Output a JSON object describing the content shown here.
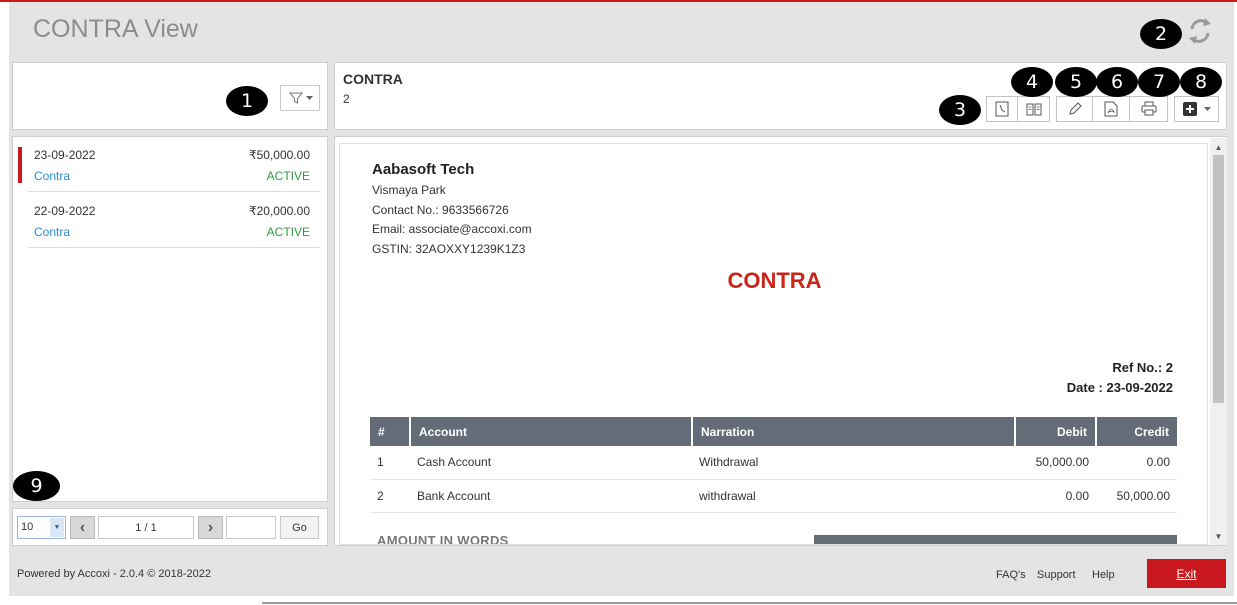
{
  "app": {
    "title": "CONTRA View"
  },
  "callouts": [
    "1",
    "2",
    "3",
    "4",
    "5",
    "6",
    "7",
    "8",
    "9"
  ],
  "list": {
    "items": [
      {
        "date": "23-09-2022",
        "amount": "₹50,000.00",
        "type": "Contra",
        "status": "ACTIVE",
        "selected": true
      },
      {
        "date": "22-09-2022",
        "amount": "₹20,000.00",
        "type": "Contra",
        "status": "ACTIVE",
        "selected": false
      }
    ]
  },
  "pager": {
    "page_size": "10",
    "page_display": "1 / 1",
    "goto_value": "",
    "go_label": "Go"
  },
  "detail": {
    "title": "CONTRA",
    "number": "2",
    "toolbar_icons": [
      "history-icon",
      "ledger-book-icon",
      "pencil-edit-icon",
      "pdf-icon",
      "print-icon",
      "add-dropdown-icon"
    ]
  },
  "document": {
    "company_name": "Aabasoft Tech",
    "address": "Vismaya Park",
    "contact": "Contact No.: 9633566726",
    "email": "Email: associate@accoxi.com",
    "gstin": "GSTIN: 32AOXXY1239K1Z3",
    "title": "CONTRA",
    "ref": "Ref No.: 2",
    "date": "Date : 23-09-2022",
    "table": {
      "headers": [
        "#",
        "Account",
        "Narration",
        "Debit",
        "Credit"
      ],
      "rows": [
        [
          "1",
          "Cash Account",
          "Withdrawal",
          "50,000.00",
          "0.00"
        ],
        [
          "2",
          "Bank Account",
          "withdrawal",
          "0.00",
          "50,000.00"
        ]
      ]
    },
    "amount_in_words_label": "AMOUNT IN WORDS"
  },
  "footer": {
    "powered_by": "Powered by Accoxi - 2.0.4 © 2018-2022",
    "links": [
      "FAQ's",
      "Support",
      "Help"
    ],
    "exit_label": "Exit"
  },
  "colors": {
    "accent": "#c9181e",
    "table_header": "#646d77",
    "link_blue": "#2f8bd1",
    "status_green": "#2e9b3e"
  }
}
